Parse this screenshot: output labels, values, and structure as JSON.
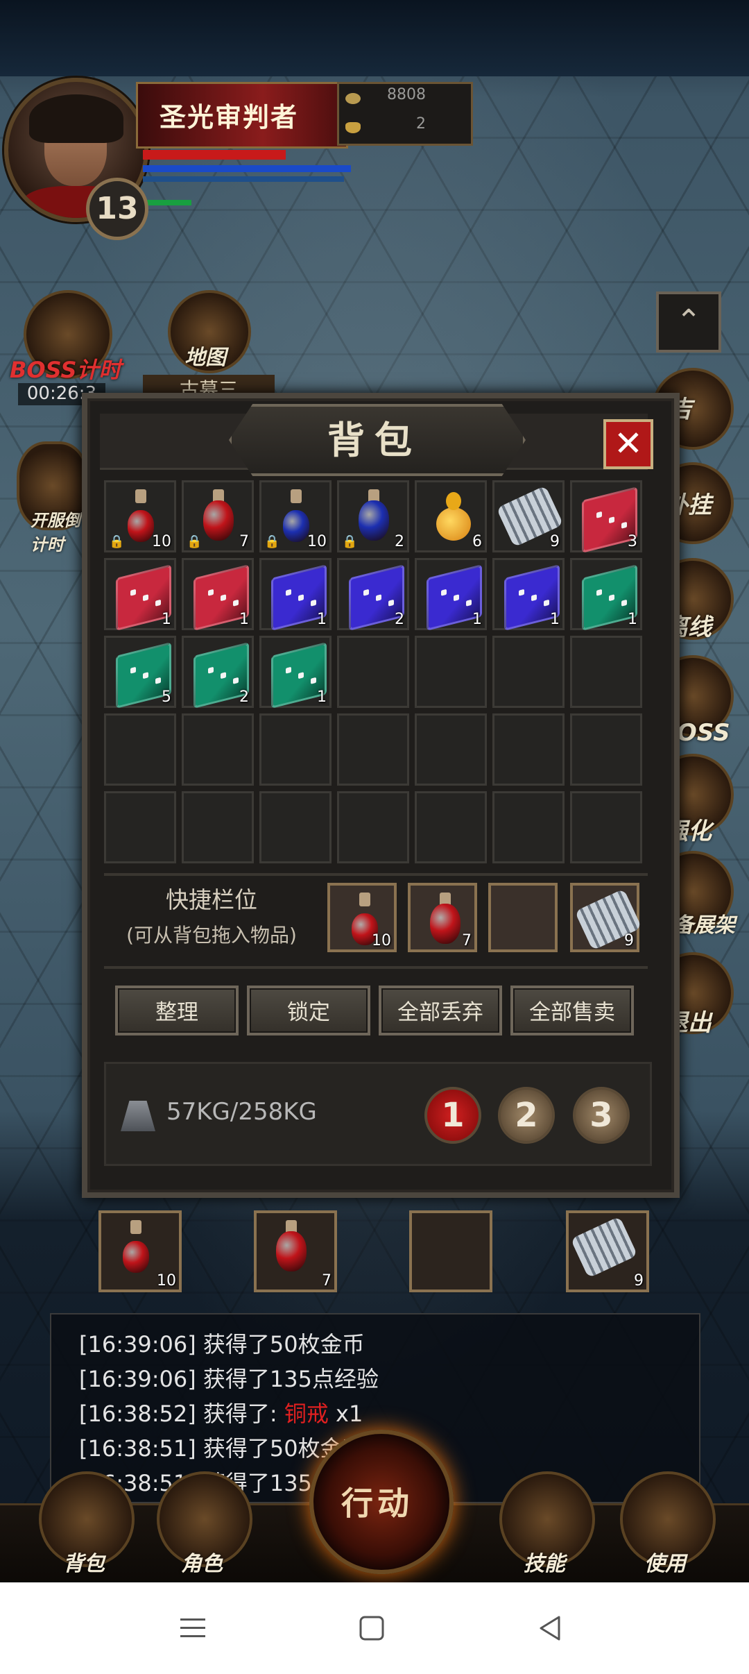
{
  "player": {
    "name": "圣光审判者",
    "level": "13",
    "gold": "8808",
    "ingots": "2"
  },
  "hud": {
    "boss_timer_label": "BOSS计时",
    "boss_timer": "00:26:3",
    "map_label": "地图",
    "map_name": "古墓三",
    "open_server_label": "开服倒计时"
  },
  "side_buttons": [
    "吉",
    "外挂",
    "离线",
    "BOSS",
    "强化",
    "装备展架",
    "退出"
  ],
  "bag": {
    "title": "背包",
    "slots": [
      {
        "item": "red-potion-small",
        "count": "10",
        "locked": true
      },
      {
        "item": "red-potion-large",
        "count": "7",
        "locked": true
      },
      {
        "item": "blue-potion-small",
        "count": "10",
        "locked": true
      },
      {
        "item": "blue-potion-large",
        "count": "2",
        "locked": true
      },
      {
        "item": "gold-gourd",
        "count": "6",
        "locked": false
      },
      {
        "item": "silver-scroll",
        "count": "9",
        "locked": false
      },
      {
        "item": "red-book",
        "count": "3",
        "locked": false
      },
      {
        "item": "red-book",
        "count": "1",
        "locked": false
      },
      {
        "item": "red-book",
        "count": "1",
        "locked": false
      },
      {
        "item": "blue-book",
        "count": "1",
        "locked": false
      },
      {
        "item": "blue-book",
        "count": "2",
        "locked": false
      },
      {
        "item": "blue-book",
        "count": "1",
        "locked": false
      },
      {
        "item": "blue-book",
        "count": "1",
        "locked": false
      },
      {
        "item": "green-book",
        "count": "1",
        "locked": false
      },
      {
        "item": "green-book",
        "count": "5",
        "locked": false
      },
      {
        "item": "green-book",
        "count": "2",
        "locked": false
      },
      {
        "item": "green-book",
        "count": "1",
        "locked": false
      }
    ],
    "quick_title": "快捷栏位",
    "quick_sub": "(可从背包拖入物品)",
    "quick_slots": [
      {
        "item": "red-potion-small",
        "count": "10"
      },
      {
        "item": "red-potion-large",
        "count": "7"
      },
      {
        "item": "",
        "count": ""
      },
      {
        "item": "silver-scroll",
        "count": "9"
      }
    ],
    "buttons": {
      "sort": "整理",
      "lock": "锁定",
      "discard_all": "全部丢弃",
      "sell_all": "全部售卖"
    },
    "weight": "57KG/258KG",
    "pages": [
      "1",
      "2",
      "3"
    ],
    "close": "✕"
  },
  "hotbar": [
    {
      "item": "red-potion-small",
      "count": "10"
    },
    {
      "item": "red-potion-large",
      "count": "7"
    },
    {
      "item": "",
      "count": ""
    },
    {
      "item": "silver-scroll",
      "count": "9"
    }
  ],
  "chat": [
    {
      "time": "[16:39:06]",
      "text": "获得了50枚金币",
      "highlight": "",
      "suffix": ""
    },
    {
      "time": "[16:39:06]",
      "text": "获得了135点经验",
      "highlight": "",
      "suffix": ""
    },
    {
      "time": "[16:38:52]",
      "text": "获得了: ",
      "highlight": "铜戒",
      "suffix": " x1"
    },
    {
      "time": "[16:38:51]",
      "text": "获得了50枚金币",
      "highlight": "",
      "suffix": ""
    },
    {
      "time": "[16:38:51]",
      "text": "获得了135点经验",
      "highlight": "",
      "suffix": ""
    }
  ],
  "bottom_nav": {
    "bag": "背包",
    "role": "角色",
    "action": "行动",
    "skill": "技能",
    "use": "使用"
  },
  "colors": {
    "red_potion": "#c0141a",
    "blue_potion": "#1c2fb0",
    "red_book": "#c8283e",
    "blue_book": "#3a2ad0",
    "green_book": "#12906c",
    "hp": "#c81a1a",
    "mp": "#1a4ac8",
    "exp": "#18a040"
  }
}
